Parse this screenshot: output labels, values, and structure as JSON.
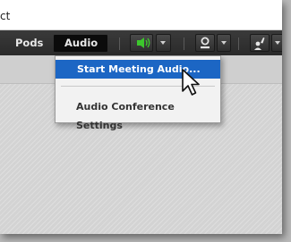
{
  "window": {
    "title": "ct"
  },
  "menubar": {
    "pods_label": "Pods",
    "audio_label": "Audio"
  },
  "audio_menu": {
    "start_label": "Start Meeting Audio...",
    "settings_label": "Audio Conference Settings"
  },
  "toolbar": {
    "speaker_icon": "speaker-icon",
    "camera_icon": "webcam-icon",
    "raise_hand_icon": "raise-hand-icon"
  },
  "colors": {
    "menubar_bg": "#2f2f2f",
    "highlight": "#1c66c4",
    "speaker_green": "#3cc72c"
  }
}
